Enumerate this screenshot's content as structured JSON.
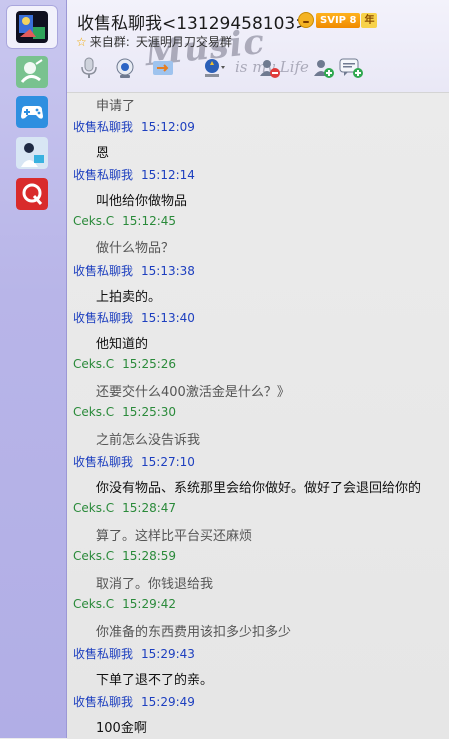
{
  "colors": {
    "me_name": "#1d3fbf",
    "other_name": "#2a8a3a",
    "sidebar_bg": "#b8b5e8"
  },
  "sidebar": {
    "items": [
      {
        "name": "current-chat-avatar"
      },
      {
        "name": "qzone"
      },
      {
        "name": "games"
      },
      {
        "name": "contact-avatar"
      },
      {
        "name": "app"
      }
    ]
  },
  "header": {
    "title": "收售私聊我<13129458103>",
    "vip_badge": "SVIP 8",
    "vip_year": "年",
    "origin_label": "来自群:",
    "origin_group": "天涯明月刀交易群",
    "watermark_main": "Music",
    "watermark_sub": "is my Life"
  },
  "toolbar": {
    "buttons": [
      {
        "icon": "microphone-icon"
      },
      {
        "icon": "video-call-icon"
      },
      {
        "icon": "file-transfer-icon"
      },
      {
        "icon": "remote-assist-icon"
      },
      {
        "icon": "block-user-icon"
      },
      {
        "icon": "add-friend-icon"
      },
      {
        "icon": "chat-bubble-add-icon"
      }
    ]
  },
  "messages": [
    {
      "text": "申请了"
    },
    {
      "sender": "收售私聊我",
      "time": "15:12:09",
      "side": "me",
      "text": "恩"
    },
    {
      "sender": "收售私聊我",
      "time": "15:12:14",
      "side": "me",
      "text": "叫他给你做物品"
    },
    {
      "sender": "Ceks.C",
      "time": "15:12:45",
      "side": "other",
      "text": "做什么物品？"
    },
    {
      "sender": "收售私聊我",
      "time": "15:13:38",
      "side": "me",
      "text": "上拍卖的。"
    },
    {
      "sender": "收售私聊我",
      "time": "15:13:40",
      "side": "me",
      "text": "他知道的"
    },
    {
      "sender": "Ceks.C",
      "time": "15:25:26",
      "side": "other",
      "text": "还要交什么400激活金是什么？》"
    },
    {
      "sender": "Ceks.C",
      "time": "15:25:30",
      "side": "other",
      "text": "之前怎么没告诉我"
    },
    {
      "sender": "收售私聊我",
      "time": "15:27:10",
      "side": "me",
      "text": "你没有物品、系统那里会给你做好。做好了会退回给你的"
    },
    {
      "sender": "Ceks.C",
      "time": "15:28:47",
      "side": "other",
      "text": "算了。这样比平台买还麻烦"
    },
    {
      "sender": "Ceks.C",
      "time": "15:28:59",
      "side": "other",
      "text": "取消了。你钱退给我"
    },
    {
      "sender": "Ceks.C",
      "time": "15:29:42",
      "side": "other",
      "text": "你准备的东西费用该扣多少扣多少"
    },
    {
      "sender": "收售私聊我",
      "time": "15:29:43",
      "side": "me",
      "text": "下单了退不了的亲。"
    },
    {
      "sender": "收售私聊我",
      "time": "15:29:49",
      "side": "me",
      "text": "100金啊"
    }
  ]
}
